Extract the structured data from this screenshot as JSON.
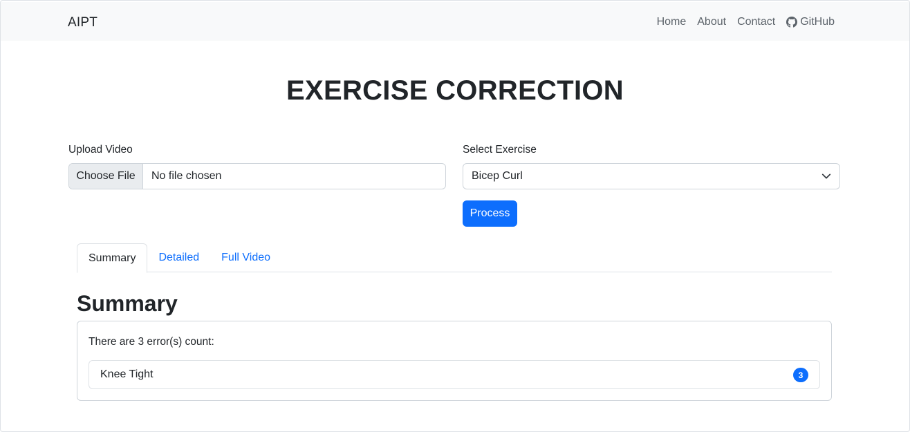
{
  "navbar": {
    "brand": "AIPT",
    "links": [
      {
        "label": "Home"
      },
      {
        "label": "About"
      },
      {
        "label": "Contact"
      },
      {
        "label": "GitHub",
        "icon": "github-icon"
      }
    ]
  },
  "page": {
    "title": "EXERCISE CORRECTION"
  },
  "upload": {
    "label": "Upload Video",
    "button_label": "Choose File",
    "status": "No file chosen"
  },
  "exercise": {
    "label": "Select Exercise",
    "selected": "Bicep Curl"
  },
  "process_button": "Process",
  "tabs": [
    {
      "label": "Summary",
      "active": true
    },
    {
      "label": "Detailed",
      "active": false
    },
    {
      "label": "Full Video",
      "active": false
    }
  ],
  "summary": {
    "title": "Summary",
    "text": "There are 3 error(s) count:",
    "items": [
      {
        "label": "Knee Tight",
        "count": "3"
      }
    ]
  },
  "colors": {
    "primary": "#0d6efd",
    "navbar_bg": "#f8f9fa"
  }
}
